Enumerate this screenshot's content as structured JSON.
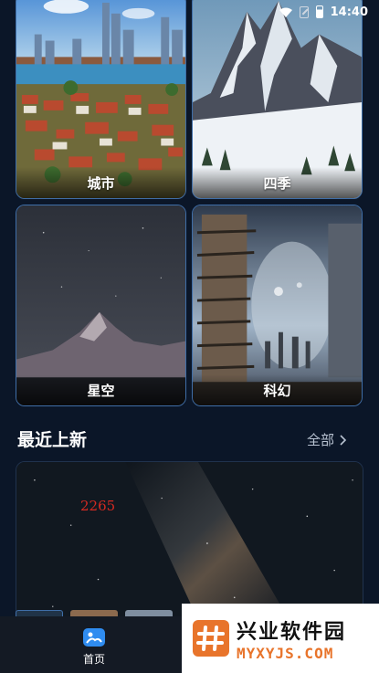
{
  "status_bar": {
    "time": "14:40"
  },
  "categories": [
    {
      "label": "城市"
    },
    {
      "label": "四季"
    },
    {
      "label": "星空"
    },
    {
      "label": "科幻"
    }
  ],
  "section": {
    "title": "最近上新",
    "more_label": "全部"
  },
  "featured": {
    "overlay_number": "2265"
  },
  "bottom_nav": {
    "home_label": "首页"
  },
  "watermark": {
    "title": "兴业软件园",
    "url": "MYXYJS.COM"
  },
  "colors": {
    "background": "#0b1628",
    "card_border": "#3f6ea8",
    "watermark_orange": "#e8742b"
  }
}
